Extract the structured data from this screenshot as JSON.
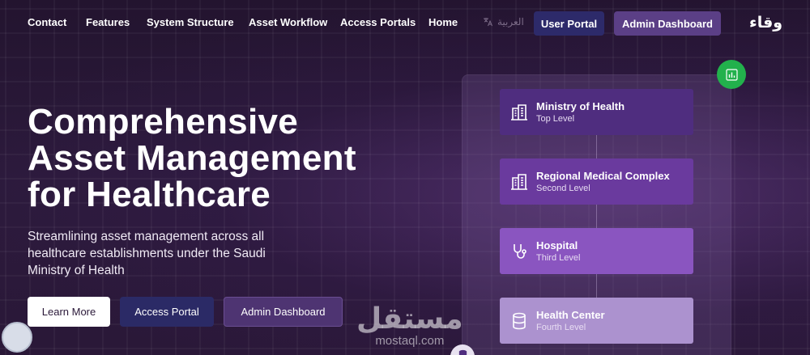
{
  "nav": {
    "links": [
      "Contact",
      "Features",
      "System Structure",
      "Asset Workflow",
      "Access Portals",
      "Home"
    ],
    "language_label": "العربية",
    "user_portal": "User Portal",
    "admin_dashboard": "Admin Dashboard",
    "logo": "وقاء"
  },
  "hero": {
    "title_line1": "Comprehensive",
    "title_line2": "Asset Management",
    "title_line3": "for Healthcare",
    "subtitle": "Streamlining asset management across all healthcare establishments under the Saudi Ministry of Health",
    "learn_more": "Learn More",
    "access_portal": "Access Portal",
    "admin_dashboard": "Admin Dashboard"
  },
  "structure": {
    "levels": [
      {
        "name": "Ministry of Health",
        "sub": "Top Level",
        "color": "#4f2d7f",
        "icon": "building-icon"
      },
      {
        "name": "Regional Medical Complex",
        "sub": "Second Level",
        "color": "#6a3a9e",
        "icon": "building-icon"
      },
      {
        "name": "Hospital",
        "sub": "Third Level",
        "color": "#8a55c0",
        "icon": "stethoscope-icon"
      },
      {
        "name": "Health Center",
        "sub": "Fourth Level",
        "color": "#ac92cf",
        "icon": "database-icon"
      }
    ]
  },
  "colors": {
    "background": "#2a1838",
    "accent_green": "#22b14c",
    "user_portal_btn": "#2d2a6a",
    "admin_btn": "#5b3f86"
  },
  "watermark": {
    "arabic": "مستقل",
    "latin": "mostaql.com"
  }
}
